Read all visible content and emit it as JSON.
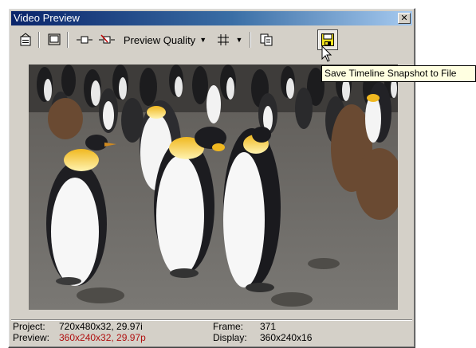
{
  "window": {
    "title": "Video Preview",
    "close_glyph": "✕"
  },
  "toolbar": {
    "items": [
      {
        "name": "properties-icon"
      },
      {
        "name": "video-output-icon"
      },
      {
        "name": "split-screen-icon"
      },
      {
        "name": "split-screen-off-icon"
      },
      {
        "name": "preview-quality-dropdown",
        "label": "Preview Quality"
      },
      {
        "name": "overlays-dropdown",
        "icon": "grid-icon"
      },
      {
        "name": "copy-snapshot-icon"
      },
      {
        "name": "save-snapshot-icon",
        "state": "hovered"
      }
    ],
    "preview_quality_label": "Preview Quality"
  },
  "tooltip": {
    "text": "Save Timeline Snapshot to File"
  },
  "preview": {
    "content": "video-frame-penguins"
  },
  "status": {
    "project_label": "Project:",
    "project_value": "720x480x32, 29.97i",
    "preview_label": "Preview:",
    "preview_value": "360x240x32, 29.97p",
    "frame_label": "Frame:",
    "frame_value": "371",
    "display_label": "Display:",
    "display_value": "360x240x16"
  },
  "colors": {
    "titlebar_start": "#0a246a",
    "titlebar_end": "#a6caf0",
    "preview_value": "#b01010",
    "tooltip_bg": "#ffffe1",
    "save_icon_yellow": "#f2e21e"
  }
}
